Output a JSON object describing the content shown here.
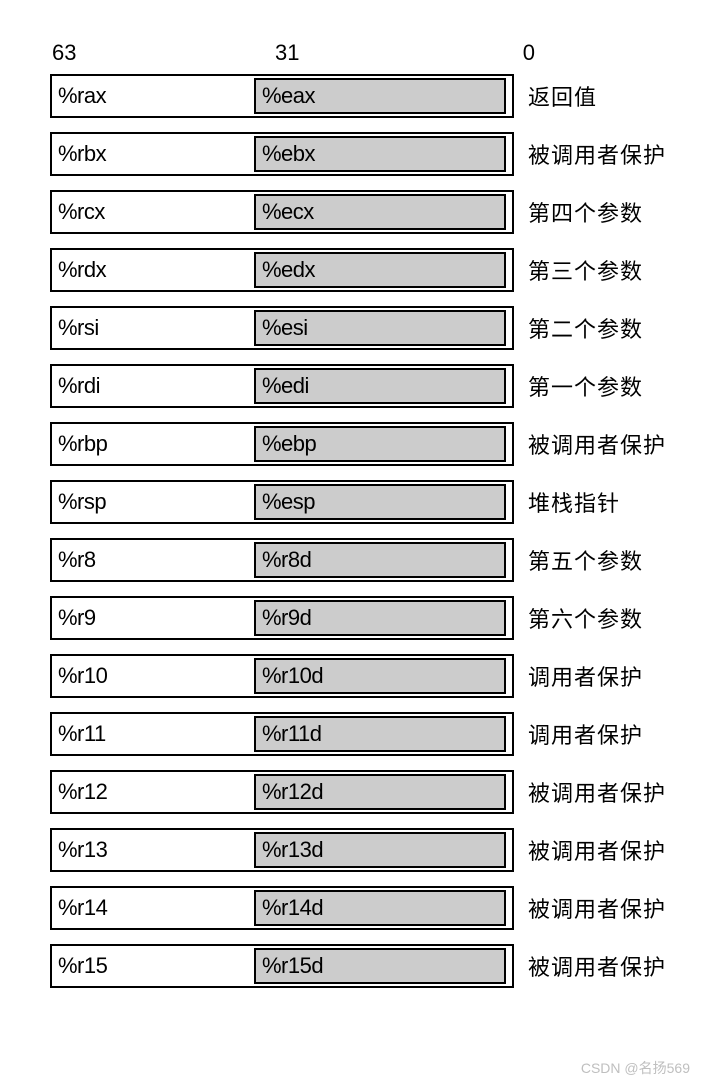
{
  "bit_labels": {
    "high": "63",
    "mid": "31",
    "low": "0"
  },
  "registers": [
    {
      "r64": "%rax",
      "r32": "%eax",
      "desc": "返回值"
    },
    {
      "r64": "%rbx",
      "r32": "%ebx",
      "desc": "被调用者保护"
    },
    {
      "r64": "%rcx",
      "r32": "%ecx",
      "desc": "第四个参数"
    },
    {
      "r64": "%rdx",
      "r32": "%edx",
      "desc": "第三个参数"
    },
    {
      "r64": "%rsi",
      "r32": "%esi",
      "desc": "第二个参数"
    },
    {
      "r64": "%rdi",
      "r32": "%edi",
      "desc": "第一个参数"
    },
    {
      "r64": "%rbp",
      "r32": "%ebp",
      "desc": "被调用者保护"
    },
    {
      "r64": "%rsp",
      "r32": "%esp",
      "desc": "堆栈指针"
    },
    {
      "r64": "%r8",
      "r32": "%r8d",
      "desc": "第五个参数"
    },
    {
      "r64": "%r9",
      "r32": "%r9d",
      "desc": "第六个参数"
    },
    {
      "r64": "%r10",
      "r32": "%r10d",
      "desc": "调用者保护"
    },
    {
      "r64": "%r11",
      "r32": "%r11d",
      "desc": "调用者保护"
    },
    {
      "r64": "%r12",
      "r32": "%r12d",
      "desc": "被调用者保护"
    },
    {
      "r64": "%r13",
      "r32": "%r13d",
      "desc": "被调用者保护"
    },
    {
      "r64": "%r14",
      "r32": "%r14d",
      "desc": "被调用者保护"
    },
    {
      "r64": "%r15",
      "r32": "%r15d",
      "desc": "被调用者保护"
    }
  ],
  "watermark": "CSDN @名扬569"
}
